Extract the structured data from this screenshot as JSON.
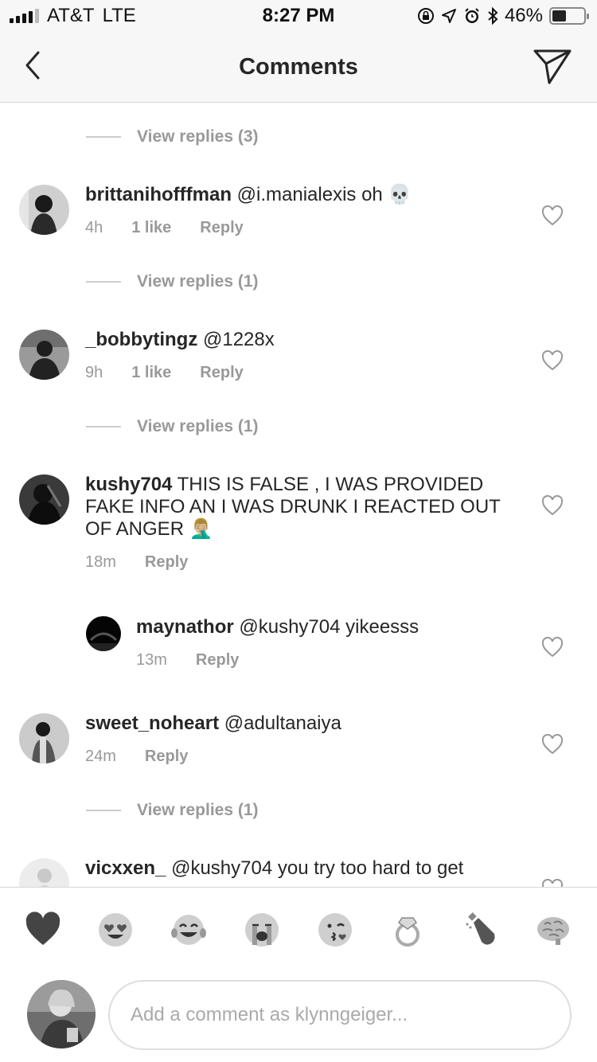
{
  "status_bar": {
    "carrier": "AT&T",
    "network": "LTE",
    "time": "8:27 PM",
    "battery_percent": "46%",
    "battery_level": 0.46,
    "icons": [
      "signal-icon",
      "rotation-lock-icon",
      "location-icon",
      "alarm-icon",
      "bluetooth-icon",
      "battery-icon"
    ]
  },
  "nav": {
    "title": "Comments",
    "back_icon": "chevron-left-icon",
    "send_icon": "direct-send-icon"
  },
  "view_replies": [
    "View replies (3)",
    "View replies (1)",
    "View replies (1)",
    "View replies (1)"
  ],
  "comments": [
    {
      "username": "brittanihofffman",
      "text": "@i.manialexis oh 💀",
      "time": "4h",
      "likes": "1 like",
      "reply": "Reply"
    },
    {
      "username": "_bobbytingz",
      "text": "@1228x",
      "time": "9h",
      "likes": "1 like",
      "reply": "Reply"
    },
    {
      "username": "kushy704",
      "text_line1": "THIS IS FALSE , I WAS PROVIDED",
      "text_line2": "FAKE INFO AN I WAS DRUNK I REACTED OUT",
      "text_line3": "OF ANGER 🤦🏼‍♂️",
      "time": "18m",
      "reply": "Reply"
    },
    {
      "username": "maynathor",
      "text": "@kushy704 yikeesss",
      "time": "13m",
      "reply": "Reply"
    },
    {
      "username": "sweet_noheart",
      "text": "@adultanaiya",
      "time": "24m",
      "reply": "Reply"
    },
    {
      "username": "vicxxen_",
      "text": "@kushy704 you try too hard to get"
    }
  ],
  "emoji_bar": [
    "🖤",
    "😍",
    "😂",
    "😭",
    "😘",
    "💍",
    "🍾",
    "🧠"
  ],
  "input": {
    "placeholder": "Add a comment as klynngeiger..."
  }
}
